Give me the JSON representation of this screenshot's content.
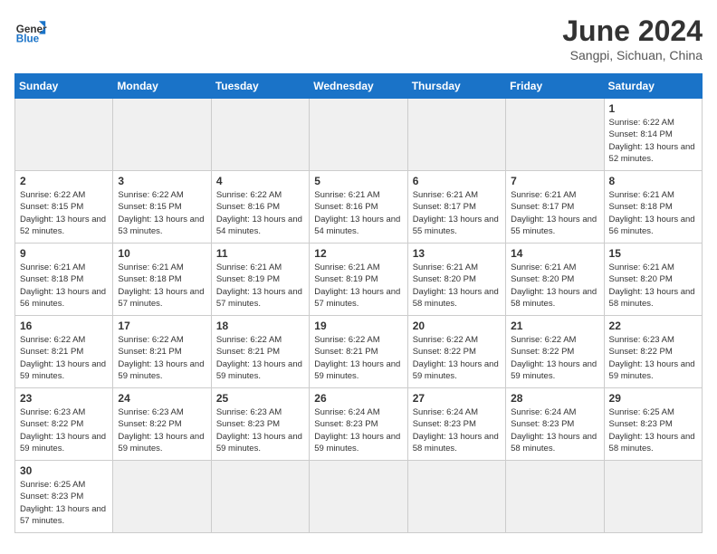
{
  "header": {
    "logo_general": "General",
    "logo_blue": "Blue",
    "month_title": "June 2024",
    "subtitle": "Sangpi, Sichuan, China"
  },
  "weekdays": [
    "Sunday",
    "Monday",
    "Tuesday",
    "Wednesday",
    "Thursday",
    "Friday",
    "Saturday"
  ],
  "weeks": [
    [
      {
        "day": "",
        "empty": true
      },
      {
        "day": "",
        "empty": true
      },
      {
        "day": "",
        "empty": true
      },
      {
        "day": "",
        "empty": true
      },
      {
        "day": "",
        "empty": true
      },
      {
        "day": "",
        "empty": true
      },
      {
        "day": "1",
        "sunrise": "6:22 AM",
        "sunset": "8:14 PM",
        "daylight": "13 hours and 52 minutes."
      }
    ],
    [
      {
        "day": "2",
        "sunrise": "6:22 AM",
        "sunset": "8:15 PM",
        "daylight": "13 hours and 52 minutes."
      },
      {
        "day": "3",
        "sunrise": "6:22 AM",
        "sunset": "8:15 PM",
        "daylight": "13 hours and 53 minutes."
      },
      {
        "day": "4",
        "sunrise": "6:22 AM",
        "sunset": "8:16 PM",
        "daylight": "13 hours and 54 minutes."
      },
      {
        "day": "5",
        "sunrise": "6:21 AM",
        "sunset": "8:16 PM",
        "daylight": "13 hours and 54 minutes."
      },
      {
        "day": "6",
        "sunrise": "6:21 AM",
        "sunset": "8:17 PM",
        "daylight": "13 hours and 55 minutes."
      },
      {
        "day": "7",
        "sunrise": "6:21 AM",
        "sunset": "8:17 PM",
        "daylight": "13 hours and 55 minutes."
      },
      {
        "day": "8",
        "sunrise": "6:21 AM",
        "sunset": "8:18 PM",
        "daylight": "13 hours and 56 minutes."
      }
    ],
    [
      {
        "day": "9",
        "sunrise": "6:21 AM",
        "sunset": "8:18 PM",
        "daylight": "13 hours and 56 minutes."
      },
      {
        "day": "10",
        "sunrise": "6:21 AM",
        "sunset": "8:18 PM",
        "daylight": "13 hours and 57 minutes."
      },
      {
        "day": "11",
        "sunrise": "6:21 AM",
        "sunset": "8:19 PM",
        "daylight": "13 hours and 57 minutes."
      },
      {
        "day": "12",
        "sunrise": "6:21 AM",
        "sunset": "8:19 PM",
        "daylight": "13 hours and 57 minutes."
      },
      {
        "day": "13",
        "sunrise": "6:21 AM",
        "sunset": "8:20 PM",
        "daylight": "13 hours and 58 minutes."
      },
      {
        "day": "14",
        "sunrise": "6:21 AM",
        "sunset": "8:20 PM",
        "daylight": "13 hours and 58 minutes."
      },
      {
        "day": "15",
        "sunrise": "6:21 AM",
        "sunset": "8:20 PM",
        "daylight": "13 hours and 58 minutes."
      }
    ],
    [
      {
        "day": "16",
        "sunrise": "6:22 AM",
        "sunset": "8:21 PM",
        "daylight": "13 hours and 59 minutes."
      },
      {
        "day": "17",
        "sunrise": "6:22 AM",
        "sunset": "8:21 PM",
        "daylight": "13 hours and 59 minutes."
      },
      {
        "day": "18",
        "sunrise": "6:22 AM",
        "sunset": "8:21 PM",
        "daylight": "13 hours and 59 minutes."
      },
      {
        "day": "19",
        "sunrise": "6:22 AM",
        "sunset": "8:21 PM",
        "daylight": "13 hours and 59 minutes."
      },
      {
        "day": "20",
        "sunrise": "6:22 AM",
        "sunset": "8:22 PM",
        "daylight": "13 hours and 59 minutes."
      },
      {
        "day": "21",
        "sunrise": "6:22 AM",
        "sunset": "8:22 PM",
        "daylight": "13 hours and 59 minutes."
      },
      {
        "day": "22",
        "sunrise": "6:23 AM",
        "sunset": "8:22 PM",
        "daylight": "13 hours and 59 minutes."
      }
    ],
    [
      {
        "day": "23",
        "sunrise": "6:23 AM",
        "sunset": "8:22 PM",
        "daylight": "13 hours and 59 minutes."
      },
      {
        "day": "24",
        "sunrise": "6:23 AM",
        "sunset": "8:22 PM",
        "daylight": "13 hours and 59 minutes."
      },
      {
        "day": "25",
        "sunrise": "6:23 AM",
        "sunset": "8:23 PM",
        "daylight": "13 hours and 59 minutes."
      },
      {
        "day": "26",
        "sunrise": "6:24 AM",
        "sunset": "8:23 PM",
        "daylight": "13 hours and 59 minutes."
      },
      {
        "day": "27",
        "sunrise": "6:24 AM",
        "sunset": "8:23 PM",
        "daylight": "13 hours and 58 minutes."
      },
      {
        "day": "28",
        "sunrise": "6:24 AM",
        "sunset": "8:23 PM",
        "daylight": "13 hours and 58 minutes."
      },
      {
        "day": "29",
        "sunrise": "6:25 AM",
        "sunset": "8:23 PM",
        "daylight": "13 hours and 58 minutes."
      }
    ],
    [
      {
        "day": "30",
        "sunrise": "6:25 AM",
        "sunset": "8:23 PM",
        "daylight": "13 hours and 57 minutes."
      },
      {
        "day": "",
        "empty": true
      },
      {
        "day": "",
        "empty": true
      },
      {
        "day": "",
        "empty": true
      },
      {
        "day": "",
        "empty": true
      },
      {
        "day": "",
        "empty": true
      },
      {
        "day": "",
        "empty": true
      }
    ]
  ]
}
